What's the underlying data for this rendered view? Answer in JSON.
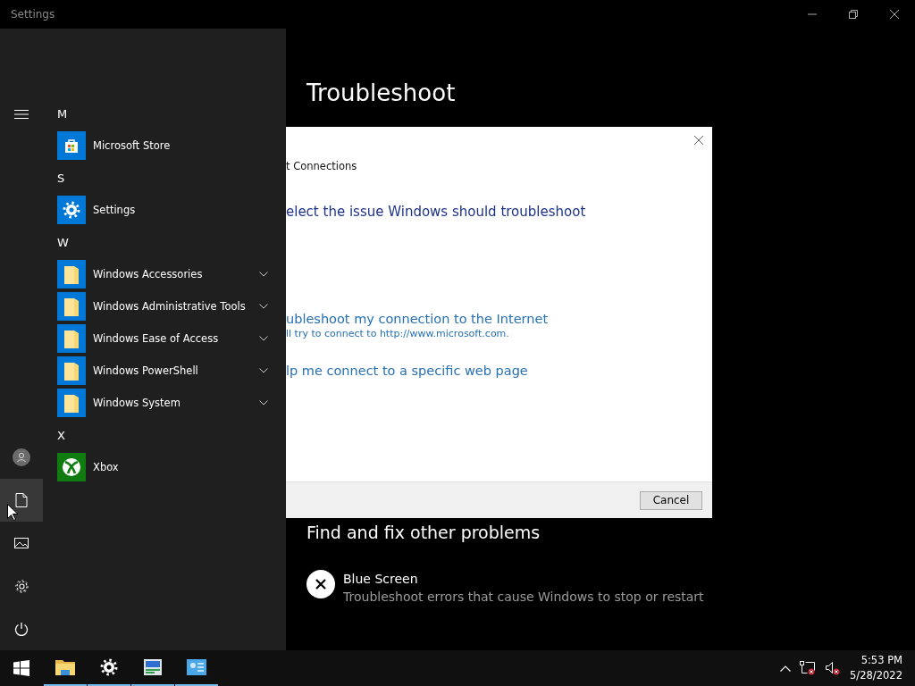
{
  "window": {
    "title": "Settings"
  },
  "settings_page": {
    "heading": "Troubleshoot",
    "section_heading": "Find and fix other problems",
    "items": [
      {
        "title": "Blue Screen",
        "description": "Troubleshoot errors that cause Windows to stop or restart"
      }
    ]
  },
  "dialog": {
    "title": "t Connections",
    "prompt": "elect the issue Windows should troubleshoot",
    "options": [
      {
        "title": "ubleshoot my connection to the Internet",
        "description": "ll try to connect to http://www.microsoft.com."
      },
      {
        "title": "lp me connect to a specific web page"
      }
    ],
    "buttons": [
      "Cancel"
    ]
  },
  "start_menu": {
    "rail_top": [
      {
        "kind": "menu",
        "selected": false
      }
    ],
    "rail_bottom": [
      {
        "kind": "user",
        "selected": false
      },
      {
        "kind": "documents",
        "selected": true
      },
      {
        "kind": "pictures",
        "selected": false
      },
      {
        "kind": "settings",
        "selected": false
      },
      {
        "kind": "power",
        "selected": false
      }
    ],
    "groups": [
      {
        "letter": "M",
        "apps": [
          {
            "name": "Microsoft Store",
            "kind": "store",
            "expandable": false
          }
        ]
      },
      {
        "letter": "S",
        "apps": [
          {
            "name": "Settings",
            "kind": "settings",
            "expandable": false
          }
        ]
      },
      {
        "letter": "W",
        "apps": [
          {
            "name": "Windows Accessories",
            "kind": "folder",
            "expandable": true
          },
          {
            "name": "Windows Administrative Tools",
            "kind": "folder",
            "expandable": true
          },
          {
            "name": "Windows Ease of Access",
            "kind": "folder",
            "expandable": true
          },
          {
            "name": "Windows PowerShell",
            "kind": "folder",
            "expandable": true
          },
          {
            "name": "Windows System",
            "kind": "folder",
            "expandable": true
          }
        ]
      },
      {
        "letter": "X",
        "apps": [
          {
            "name": "Xbox",
            "kind": "xbox",
            "expandable": false
          }
        ]
      }
    ]
  },
  "taskbar": {
    "apps": [
      {
        "kind": "explorer",
        "running": true
      },
      {
        "kind": "settings",
        "running": true
      },
      {
        "kind": "display",
        "running": true
      },
      {
        "kind": "control",
        "running": true
      }
    ],
    "tray": [
      {
        "kind": "chevron"
      },
      {
        "kind": "network",
        "error": true
      },
      {
        "kind": "volume",
        "error": true
      }
    ],
    "time": "5:53 PM",
    "date": "5/28/2022"
  }
}
